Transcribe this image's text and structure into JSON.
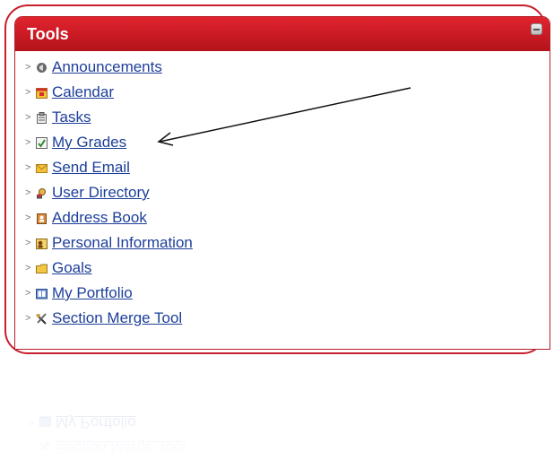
{
  "module": {
    "title": "Tools",
    "items": [
      {
        "label": "Announcements",
        "icon": "megaphone-icon"
      },
      {
        "label": "Calendar",
        "icon": "calendar-icon"
      },
      {
        "label": "Tasks",
        "icon": "tasks-icon"
      },
      {
        "label": "My Grades",
        "icon": "grades-icon"
      },
      {
        "label": "Send Email",
        "icon": "envelope-icon"
      },
      {
        "label": "User Directory",
        "icon": "user-directory-icon"
      },
      {
        "label": "Address Book",
        "icon": "address-book-icon"
      },
      {
        "label": "Personal Information",
        "icon": "personal-info-icon"
      },
      {
        "label": "Goals",
        "icon": "folder-icon"
      },
      {
        "label": "My Portfolio",
        "icon": "portfolio-icon"
      },
      {
        "label": "Section Merge Tool",
        "icon": "tools-icon"
      }
    ]
  },
  "reflection": {
    "items": [
      "Section Merge Tool",
      "My Portfolio"
    ]
  },
  "colors": {
    "accent": "#c81e2b",
    "link": "#1d3f9a"
  }
}
